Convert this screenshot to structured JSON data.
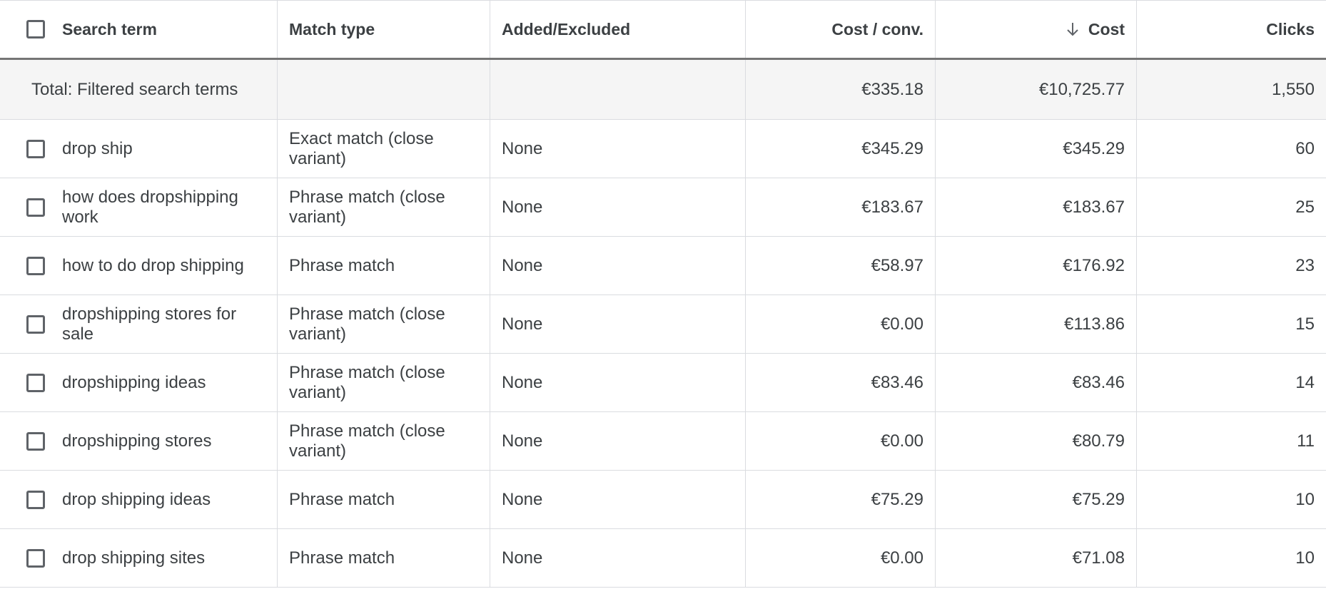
{
  "table": {
    "columns": {
      "search_term": "Search term",
      "match_type": "Match type",
      "added_excluded": "Added/Excluded",
      "cost_per_conv": "Cost / conv.",
      "cost": "Cost",
      "clicks": "Clicks"
    },
    "sorted_column": "cost",
    "sort_direction": "descending",
    "total": {
      "label": "Total: Filtered search terms",
      "cost_per_conv": "€335.18",
      "cost": "€10,725.77",
      "clicks": "1,550"
    },
    "rows": [
      {
        "search_term": "drop ship",
        "match_type": "Exact match (close variant)",
        "added_excluded": "None",
        "cost_per_conv": "€345.29",
        "cost": "€345.29",
        "clicks": "60"
      },
      {
        "search_term": "how does dropshipping work",
        "match_type": "Phrase match (close variant)",
        "added_excluded": "None",
        "cost_per_conv": "€183.67",
        "cost": "€183.67",
        "clicks": "25"
      },
      {
        "search_term": "how to do drop shipping",
        "match_type": "Phrase match",
        "added_excluded": "None",
        "cost_per_conv": "€58.97",
        "cost": "€176.92",
        "clicks": "23"
      },
      {
        "search_term": "dropshipping stores for sale",
        "match_type": "Phrase match (close variant)",
        "added_excluded": "None",
        "cost_per_conv": "€0.00",
        "cost": "€113.86",
        "clicks": "15"
      },
      {
        "search_term": "dropshipping ideas",
        "match_type": "Phrase match (close variant)",
        "added_excluded": "None",
        "cost_per_conv": "€83.46",
        "cost": "€83.46",
        "clicks": "14"
      },
      {
        "search_term": "dropshipping stores",
        "match_type": "Phrase match (close variant)",
        "added_excluded": "None",
        "cost_per_conv": "€0.00",
        "cost": "€80.79",
        "clicks": "11"
      },
      {
        "search_term": "drop shipping ideas",
        "match_type": "Phrase match",
        "added_excluded": "None",
        "cost_per_conv": "€75.29",
        "cost": "€75.29",
        "clicks": "10"
      },
      {
        "search_term": "drop shipping sites",
        "match_type": "Phrase match",
        "added_excluded": "None",
        "cost_per_conv": "€0.00",
        "cost": "€71.08",
        "clicks": "10"
      }
    ]
  }
}
